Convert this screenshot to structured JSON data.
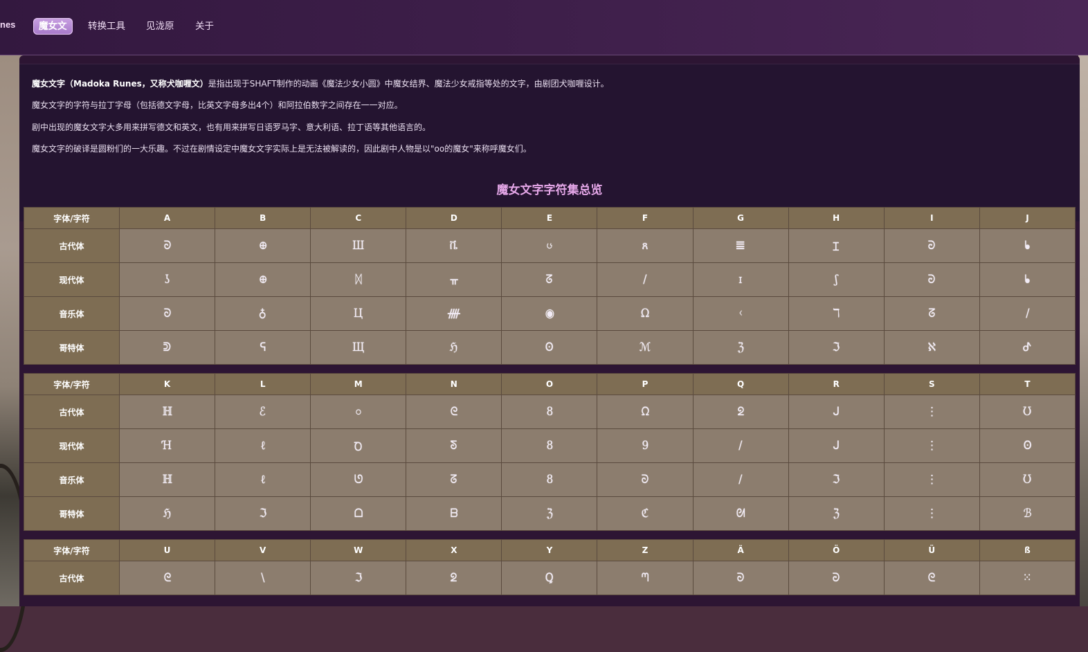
{
  "nav": {
    "brand": "nes",
    "items": [
      {
        "label": "魔女文",
        "active": true
      },
      {
        "label": "转换工具",
        "active": false
      },
      {
        "label": "见泷原",
        "active": false
      },
      {
        "label": "关于",
        "active": false
      }
    ]
  },
  "intro": {
    "p1_bold1": "魔女文字（Madoka Runes，又称犬咖喱文）",
    "p1_rest": "是指出现于SHAFT制作的动画《魔法少女小圆》中魔女结界、魔法少女戒指等处的文字，由剧团犬咖喱设计。",
    "p2": "魔女文字的字符与拉丁字母（包括德文字母，比英文字母多出4个）和阿拉伯数字之间存在一一对应。",
    "p3": "剧中出现的魔女文字大多用来拼写德文和英文，也有用来拼写日语罗马字、意大利语、拉丁语等其他语言的。",
    "p4": "魔女文字的破译是圆粉们的一大乐趣。不过在剧情设定中魔女文字实际上是无法被解读的，因此剧中人物是以\"oo的魔女\"来称呼魔女们。"
  },
  "section_title": "魔女文字字符集总览",
  "table": {
    "corner": "字体/字符",
    "row_labels": [
      "古代体",
      "现代体",
      "音乐体",
      "哥特体"
    ],
    "blocks": [
      {
        "letters": [
          "A",
          "B",
          "C",
          "D",
          "E",
          "F",
          "G",
          "H",
          "I",
          "J"
        ],
        "rows": [
          [
            "ᘐ",
            "⊕",
            "Ш",
            "ቬ",
            "ၒ",
            "ጸ",
            "𝌆",
            "Ɪ",
            "ᘒ",
            "ᖲ"
          ],
          [
            "ʖ",
            "⊕",
            "ᛞ",
            "ᚂ",
            "ᘔ",
            "/",
            "ɪ",
            "ʃ",
            "ᘒ",
            "ᖲ"
          ],
          [
            "ᘐ",
            "♁",
            "Ц",
            "ᚎ",
            "◉",
            "Ω",
            "ᚲ",
            "ℸ",
            "ᘔ",
            "/"
          ],
          [
            "ᕲ",
            "ᕋ",
            "Щ",
            "ℌ",
            "Ꙩ",
            "ℳ",
            "ℨ",
            "ℑ",
            "ℵ",
            "ᕷ"
          ]
        ]
      },
      {
        "letters": [
          "K",
          "L",
          "M",
          "N",
          "O",
          "P",
          "Q",
          "R",
          "S",
          "T"
        ],
        "rows": [
          [
            "ℍ",
            "ℰ",
            "ဝ",
            "ᘓ",
            "8",
            "ᘯ",
            "ᘖ",
            "ᒍ",
            "⋮",
            "Ʊ"
          ],
          [
            "Ɦ",
            "ℓ",
            "Ꝺ",
            "ᘕ",
            "8",
            "9",
            "/",
            "ᒍ",
            "⋮",
            "Ꙩ"
          ],
          [
            "ℍ",
            "ℓ",
            "ᘎ",
            "ᘔ",
            "8",
            "ᘐ",
            "/",
            "ℑ",
            "⋮",
            "Ʊ"
          ],
          [
            "ℌ",
            "ℑ",
            "ᗝ",
            "ᗷ",
            "ℨ",
            "ℭ",
            "ᘛ",
            "ℨ",
            "⋮",
            "ℬ"
          ]
        ]
      },
      {
        "letters": [
          "U",
          "V",
          "W",
          "X",
          "Y",
          "Z",
          "Ä",
          "Ö",
          "Ü",
          "ß"
        ],
        "rows": [
          [
            "ᘓ",
            "\\",
            "ℑ",
            "ᘖ",
            "Ꝗ",
            "ᘉ",
            "ᘐ",
            "ᘒ",
            "ᘓ",
            "⁙"
          ]
        ]
      }
    ]
  }
}
